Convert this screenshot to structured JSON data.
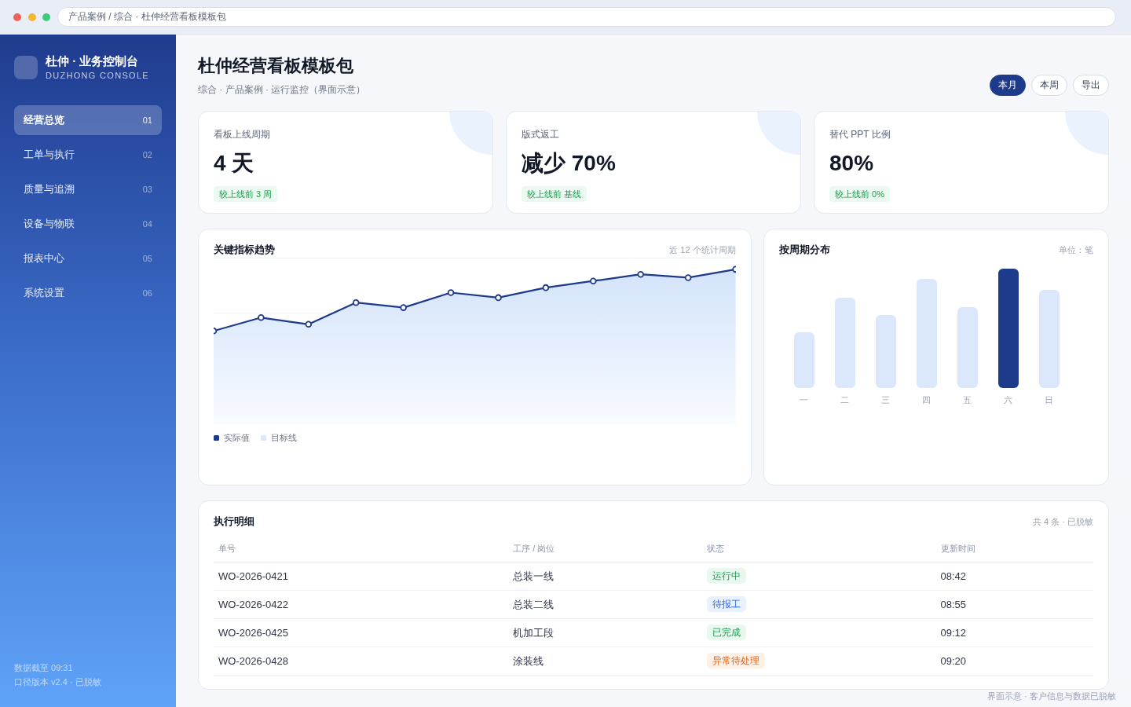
{
  "browser": {
    "address": "产品案例 / 综合 · 杜仲经营看板模板包"
  },
  "sidebar": {
    "brand": {
      "title": "杜仲 · 业务控制台",
      "subtitle": "DUZHONG CONSOLE"
    },
    "items": [
      {
        "label": "经营总览",
        "number": "01",
        "selected": true
      },
      {
        "label": "工单与执行",
        "number": "02",
        "selected": false
      },
      {
        "label": "质量与追溯",
        "number": "03",
        "selected": false
      },
      {
        "label": "设备与物联",
        "number": "04",
        "selected": false
      },
      {
        "label": "报表中心",
        "number": "05",
        "selected": false
      },
      {
        "label": "系统设置",
        "number": "06",
        "selected": false
      }
    ],
    "footer": [
      "数据截至 09:31",
      "口径版本 v2.4 · 已脱敏"
    ]
  },
  "header": {
    "title": "杜仲经营看板模板包",
    "subtitle": "综合 · 产品案例 · 运行监控（界面示意）",
    "period_tabs": [
      {
        "label": "本月",
        "selected": true
      },
      {
        "label": "本周",
        "selected": false
      }
    ],
    "export_button": "导出"
  },
  "kpis": [
    {
      "label": "看板上线周期",
      "value": "4 天",
      "change": "较上线前 3 周"
    },
    {
      "label": "版式返工",
      "value": "减少 70%",
      "change": "较上线前 基线"
    },
    {
      "label": "替代 PPT 比例",
      "value": "80%",
      "change": "较上线前 0%"
    }
  ],
  "trend_chart": {
    "title": "关键指标趋势",
    "note": "近 12 个统计周期",
    "legend": [
      {
        "label": "实际值",
        "color": "#1e3a8a"
      },
      {
        "label": "目标线",
        "color": "#dbe7fb"
      }
    ]
  },
  "distribution": {
    "title": "按周期分布",
    "unit": "单位：笔",
    "bars": [
      {
        "label": "一",
        "selected": false
      },
      {
        "label": "二",
        "selected": false
      },
      {
        "label": "三",
        "selected": false
      },
      {
        "label": "四",
        "selected": false
      },
      {
        "label": "五",
        "selected": false
      },
      {
        "label": "六",
        "selected": true
      },
      {
        "label": "日",
        "selected": false
      }
    ]
  },
  "table": {
    "title": "执行明细",
    "summary": "共 4 条 · 已脱敏",
    "columns": [
      "单号",
      "工序 / 岗位",
      "状态",
      "更新时间"
    ],
    "rows": [
      {
        "id": "WO-2026-0421",
        "process": "总装一线",
        "status": {
          "text": "运行中",
          "kind": "success"
        },
        "time": "08:42"
      },
      {
        "id": "WO-2026-0422",
        "process": "总装二线",
        "status": {
          "text": "待报工",
          "kind": "info"
        },
        "time": "08:55"
      },
      {
        "id": "WO-2026-0425",
        "process": "机加工段",
        "status": {
          "text": "已完成",
          "kind": "success"
        },
        "time": "09:12"
      },
      {
        "id": "WO-2026-0428",
        "process": "涂装线",
        "status": {
          "text": "异常待处理",
          "kind": "warning"
        },
        "time": "09:20"
      }
    ]
  },
  "footnote": "界面示意 · 客户信息与数据已脱敏"
}
